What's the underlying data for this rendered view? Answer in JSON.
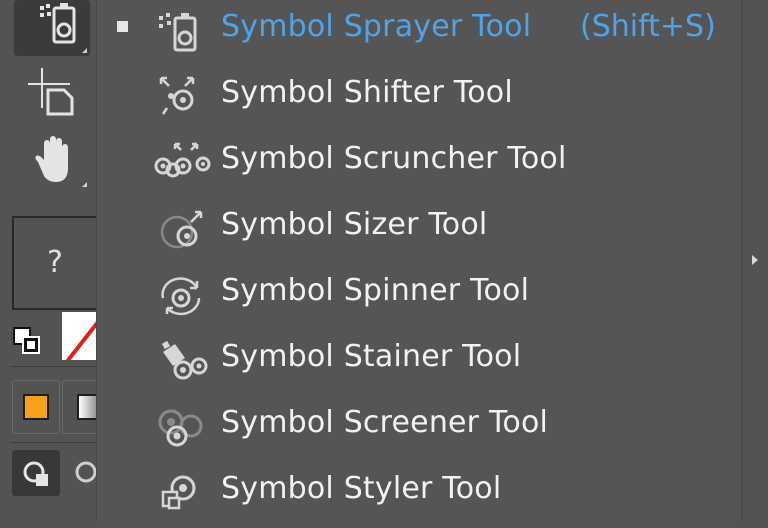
{
  "toolbar": {
    "tools": [
      {
        "name": "symbol-sprayer-tool",
        "icon": "symbol-sprayer-icon",
        "active": true
      },
      {
        "name": "artboard-tool",
        "icon": "artboard-icon"
      },
      {
        "name": "hand-tool",
        "icon": "hand-icon"
      }
    ],
    "unknown_label": "?",
    "fill_color": "#f7a01c",
    "none_color": "#e0201b"
  },
  "menu": {
    "items": [
      {
        "label": "Symbol Sprayer Tool",
        "shortcut": "(Shift+S)",
        "icon": "symbol-sprayer-icon",
        "selected": true
      },
      {
        "label": "Symbol Shifter Tool",
        "icon": "symbol-shifter-icon"
      },
      {
        "label": "Symbol Scruncher Tool",
        "icon": "symbol-scruncher-icon"
      },
      {
        "label": "Symbol Sizer Tool",
        "icon": "symbol-sizer-icon"
      },
      {
        "label": "Symbol Spinner Tool",
        "icon": "symbol-spinner-icon"
      },
      {
        "label": "Symbol Stainer Tool",
        "icon": "symbol-stainer-icon"
      },
      {
        "label": "Symbol Screener Tool",
        "icon": "symbol-screener-icon"
      },
      {
        "label": "Symbol Styler Tool",
        "icon": "symbol-styler-icon"
      }
    ],
    "selected_color": "#4fa3e8"
  }
}
